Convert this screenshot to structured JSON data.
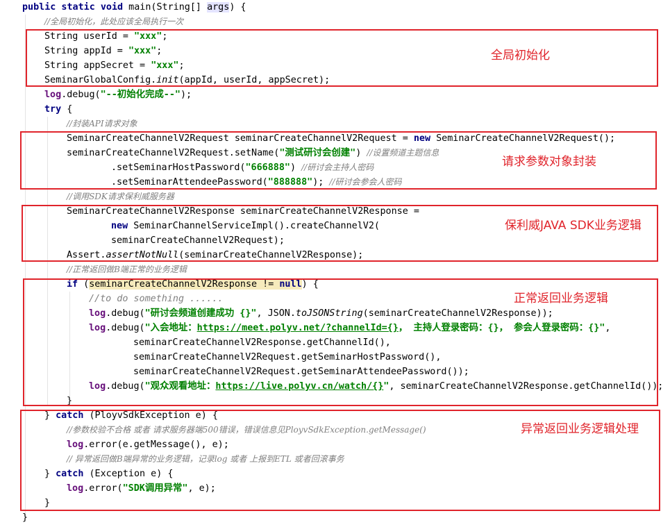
{
  "code": {
    "l1": {
      "kw1": "public static void",
      "t1": " main(String[] ",
      "arg": "args",
      "t2": ") {"
    },
    "l2": {
      "c": "//全局初始化，此处应该全局执行一次"
    },
    "l3": {
      "t1": "String userId = ",
      "s1": "\"xxx\"",
      "t2": ";"
    },
    "l4": {
      "t1": "String appId = ",
      "s1": "\"xxx\"",
      "t2": ";"
    },
    "l5": {
      "t1": "String appSecret = ",
      "s1": "\"xxx\"",
      "t2": ";"
    },
    "l6": {
      "t1": "SeminarGlobalConfig.",
      "it": "init",
      "t2": "(appId, userId, appSecret);"
    },
    "l7": {
      "f": "log",
      "t1": ".debug(",
      "s1": "\"--初始化完成--\"",
      "t2": ");"
    },
    "l8": {
      "kw1": "try",
      "t1": " {"
    },
    "l9": {
      "c": "//封装API请求对象"
    },
    "l10": {
      "t1": "SeminarCreateChannelV2Request seminarCreateChannelV2Request = ",
      "kw1": "new",
      "t2": " SeminarCreateChannelV2Request();"
    },
    "l11": {
      "t1": "seminarCreateChannelV2Request.setName(",
      "s1": "\"测试研讨会创建\"",
      "t2": ") ",
      "c": "//设置频道主题信息"
    },
    "l12": {
      "t1": ".setSeminarHostPassword(",
      "s1": "\"666888\"",
      "t2": ") ",
      "c": "//研讨会主持人密码"
    },
    "l13": {
      "t1": ".setSeminarAttendeePassword(",
      "s1": "\"888888\"",
      "t2": "); ",
      "c": "//研讨会参会人密码"
    },
    "l14": {
      "c": "//调用SDK请求保利威服务器"
    },
    "l15": {
      "t1": "SeminarCreateChannelV2Response seminarCreateChannelV2Response ="
    },
    "l16": {
      "kw1": "new",
      "t1": " SeminarChannelServiceImpl().createChannelV2("
    },
    "l17": {
      "t1": "seminarCreateChannelV2Request);"
    },
    "l18": {
      "t1": "Assert.",
      "it": "assertNotNull",
      "t2": "(seminarCreateChannelV2Response);"
    },
    "l19": {
      "c": "//正常返回做B端正常的业务逻辑"
    },
    "l20": {
      "kw1": "if",
      "t1": " (",
      "hl": "seminarCreateChannelV2Response != null",
      "kw_null": "null",
      "t2": ") {"
    },
    "l21": {
      "c": "//to do something ......"
    },
    "l22": {
      "f": "log",
      "t1": ".debug(",
      "s1": "\"研讨会频道创建成功 {}\"",
      "t2": ", JSON.",
      "it": "toJSONString",
      "t3": "(seminarCreateChannelV2Response));"
    },
    "l23": {
      "f": "log",
      "t1": ".debug(",
      "s1": "\"入会地址：",
      "lnk": "https://meet.polyv.net/?channelId={}",
      "s2": "， 主持人登录密码：{}， 参会人登录密码：{}\"",
      "t2": ","
    },
    "l24": {
      "t1": "seminarCreateChannelV2Response.getChannelId(),"
    },
    "l25": {
      "t1": "seminarCreateChannelV2Request.getSeminarHostPassword(),"
    },
    "l26": {
      "t1": "seminarCreateChannelV2Request.getSeminarAttendeePassword());"
    },
    "l27": {
      "f": "log",
      "t1": ".debug(",
      "s1": "\"观众观看地址：",
      "lnk": "https://live.polyv.cn/watch/{}",
      "s2": "\"",
      "t2": ", seminarCreateChannelV2Response.getChannelId());"
    },
    "l28": {
      "t1": "}"
    },
    "l29": {
      "t1": "} ",
      "kw1": "catch",
      "t2": " (PloyvSdkException e) {"
    },
    "l30": {
      "c": "//参数校验不合格 或者 请求服务器端500错误，错误信息见PloyvSdkException.getMessage()"
    },
    "l31": {
      "f": "log",
      "t1": ".error(e.getMessage(), e);"
    },
    "l32": {
      "c": "// 异常返回做B端异常的业务逻辑，记录log 或者 上报到ETL 或者回滚事务"
    },
    "l33": {
      "t1": "} ",
      "kw1": "catch",
      "t2": " (Exception e) {"
    },
    "l34": {
      "f": "log",
      "t1": ".error(",
      "s1": "\"SDK调用异常\"",
      "t2": ", e);"
    },
    "l35": {
      "t1": "}"
    },
    "l36": {
      "t1": "}"
    }
  },
  "annotations": {
    "global_init": "全局初始化",
    "request_params": "请求参数对象封装",
    "sdk_logic": "保利威JAVA SDK业务逻辑",
    "normal_return": "正常返回业务逻辑",
    "exception_return": "异常返回业务逻辑处理"
  },
  "colors": {
    "keyword": "#000080",
    "string": "#008000",
    "comment": "#808080",
    "field": "#660e7a",
    "annotation": "#e0242b"
  }
}
